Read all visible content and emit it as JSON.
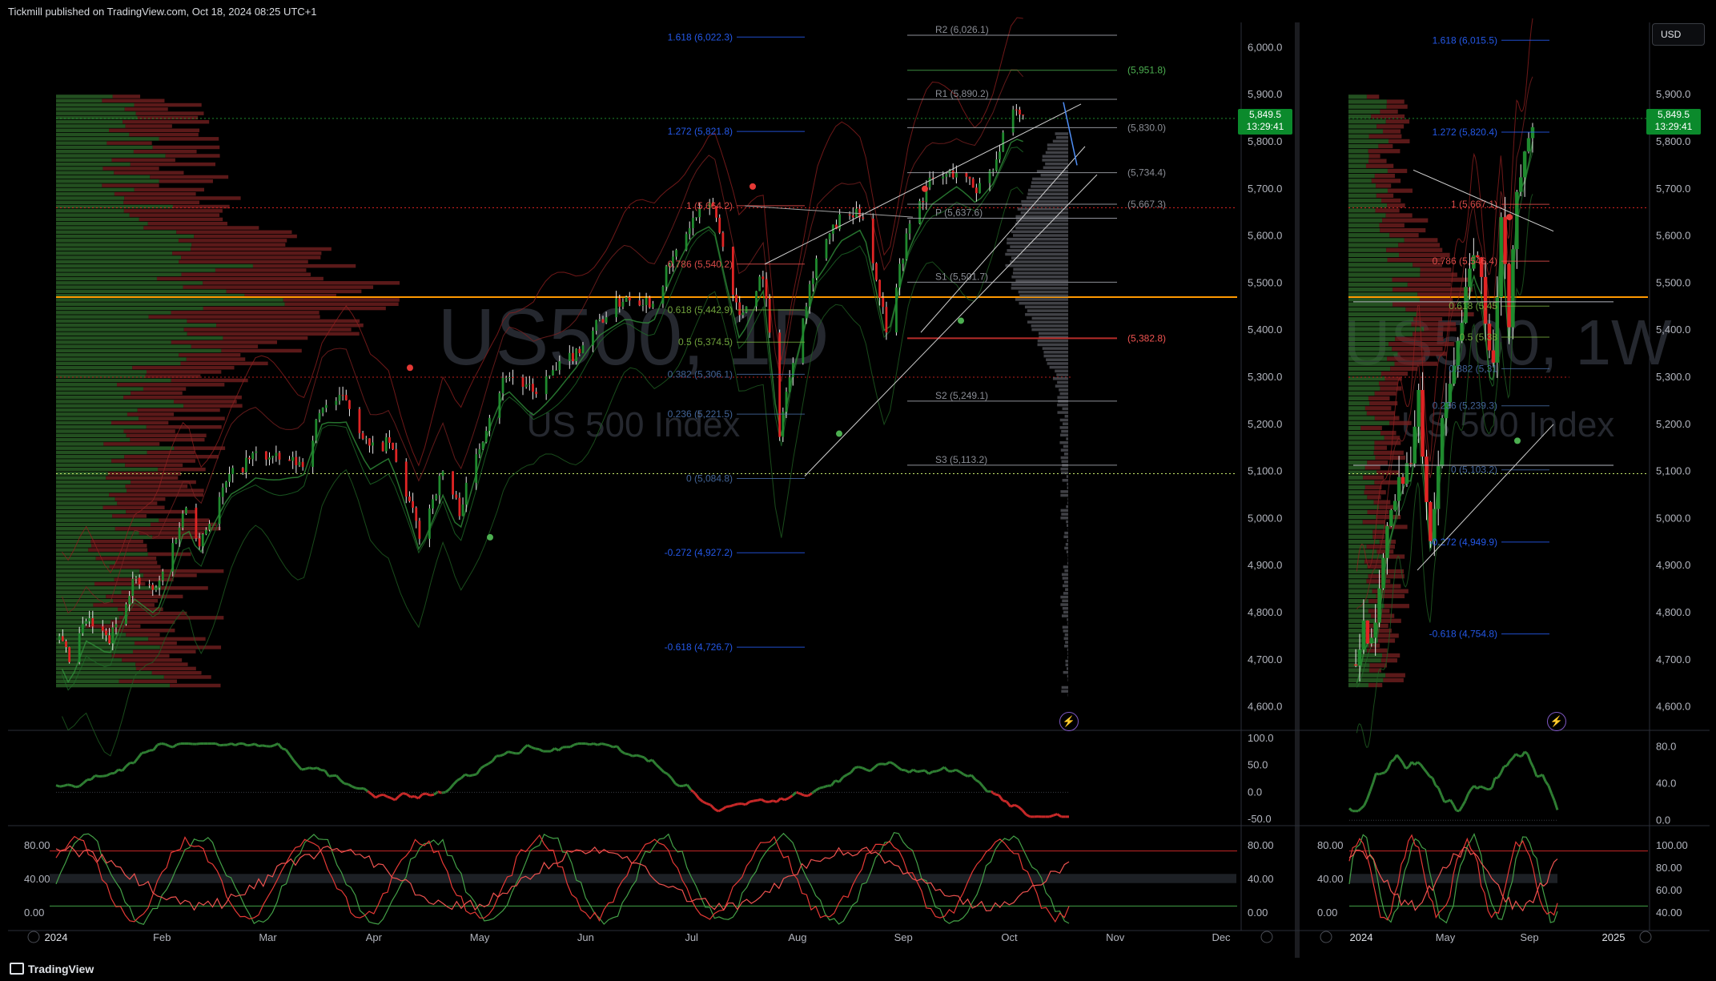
{
  "header": {
    "publish_text": "Tickmill published on TradingView.com, Oct 18, 2024 08:25 UTC+1"
  },
  "footer": {
    "brand": "TradingView"
  },
  "toolbar": {
    "currency": "USD"
  },
  "colors": {
    "up": "#1f8a2e",
    "down": "#e02424",
    "accent_orange": "#ff9800",
    "fib_blue": "#2962ff",
    "pivot_grey": "#b2b5be"
  },
  "icons": [
    "lightning-icon",
    "auto-scale-icon",
    "zoom-icon",
    "tradingview-logo-icon"
  ],
  "chart_data": [
    {
      "type": "candlestick",
      "name": "US500, 1D",
      "watermark_symbol": "US500, 1D",
      "watermark_desc": "US 500 Index",
      "current_price": "5,849.5",
      "countdown": "13:29:41",
      "ylim": [
        4550,
        6050
      ],
      "y_ticks": [
        "6,000.0",
        "5,900.0",
        "5,800.0",
        "5,700.0",
        "5,600.0",
        "5,500.0",
        "5,400.0",
        "5,300.0",
        "5,200.0",
        "5,100.0",
        "5,000.0",
        "4,900.0",
        "4,800.0",
        "4,700.0",
        "4,600.0"
      ],
      "x_ticks": [
        "2024",
        "Feb",
        "Mar",
        "Apr",
        "May",
        "Jun",
        "Jul",
        "Aug",
        "Sep",
        "Oct",
        "Nov",
        "Dec"
      ],
      "x_range": [
        "2024-01-01",
        "2024-12-31"
      ],
      "close_path": [
        [
          "2024-01-02",
          4742
        ],
        [
          "2024-01-05",
          4697
        ],
        [
          "2024-01-10",
          4783
        ],
        [
          "2024-01-17",
          4740
        ],
        [
          "2024-01-24",
          4868
        ],
        [
          "2024-01-31",
          4845
        ],
        [
          "2024-02-09",
          5026
        ],
        [
          "2024-02-13",
          4953
        ],
        [
          "2024-02-22",
          5087
        ],
        [
          "2024-03-01",
          5137
        ],
        [
          "2024-03-08",
          5123
        ],
        [
          "2024-03-15",
          5117
        ],
        [
          "2024-03-21",
          5241
        ],
        [
          "2024-03-28",
          5254
        ],
        [
          "2024-04-04",
          5147
        ],
        [
          "2024-04-10",
          5160
        ],
        [
          "2024-04-19",
          4967
        ],
        [
          "2024-04-26",
          5099
        ],
        [
          "2024-05-01",
          5018
        ],
        [
          "2024-05-10",
          5222
        ],
        [
          "2024-05-15",
          5308
        ],
        [
          "2024-05-23",
          5267
        ],
        [
          "2024-06-05",
          5354
        ],
        [
          "2024-06-12",
          5421
        ],
        [
          "2024-06-20",
          5473
        ],
        [
          "2024-06-28",
          5460
        ],
        [
          "2024-07-03",
          5537
        ],
        [
          "2024-07-10",
          5633
        ],
        [
          "2024-07-16",
          5667
        ],
        [
          "2024-07-24",
          5427
        ],
        [
          "2024-07-31",
          5522
        ],
        [
          "2024-08-05",
          5186
        ],
        [
          "2024-08-09",
          5344
        ],
        [
          "2024-08-16",
          5554
        ],
        [
          "2024-08-23",
          5634
        ],
        [
          "2024-08-30",
          5648
        ],
        [
          "2024-09-06",
          5408
        ],
        [
          "2024-09-13",
          5626
        ],
        [
          "2024-09-19",
          5713
        ],
        [
          "2024-09-27",
          5738
        ],
        [
          "2024-10-03",
          5699
        ],
        [
          "2024-10-08",
          5751
        ],
        [
          "2024-10-14",
          5859
        ],
        [
          "2024-10-17",
          5849.5
        ]
      ],
      "levels": [
        {
          "label": "R2 (6,026.1)",
          "value": 6026.1
        },
        {
          "label": "(5,951.8)",
          "value": 5951.8
        },
        {
          "label": "R1 (5,890.2)",
          "value": 5890.2
        },
        {
          "label": "(5,830.0)",
          "value": 5830.0
        },
        {
          "label": "(5,734.4)",
          "value": 5734.4
        },
        {
          "label": "(5,667.3)",
          "value": 5667.3
        },
        {
          "label": "P (5,637.6)",
          "value": 5637.6
        },
        {
          "label": "S1 (5,501.7)",
          "value": 5501.7
        },
        {
          "label": "(5,382.8)",
          "value": 5382.8
        },
        {
          "label": "S2 (5,249.1)",
          "value": 5249.1
        },
        {
          "label": "S3 (5,113.2)",
          "value": 5113.2
        }
      ],
      "fib_levels": [
        {
          "label": "1.618 (6,022.3)",
          "value": 6022.3
        },
        {
          "label": "1.272 (5,821.8)",
          "value": 5821.8
        },
        {
          "label": "1 (5,664.2)",
          "value": 5664.2
        },
        {
          "label": "0.786 (5,540.2)",
          "value": 5540.2
        },
        {
          "label": "0.618 (5,442.9)",
          "value": 5442.9
        },
        {
          "label": "0.5 (5,374.5)",
          "value": 5374.5
        },
        {
          "label": "0.382 (5,306.1)",
          "value": 5306.1
        },
        {
          "label": "0.236 (5,221.5)",
          "value": 5221.5
        },
        {
          "label": "0 (5,084.8)",
          "value": 5084.8
        },
        {
          "label": "-0.272 (4,927.2)",
          "value": 4927.2
        },
        {
          "label": "-0.618 (4,726.7)",
          "value": 4726.7
        }
      ],
      "osc1": {
        "y_ticks": [
          "100.0",
          "50.0",
          "0.0",
          "-50.0"
        ],
        "ylim": [
          -60,
          110
        ]
      },
      "osc2": {
        "y_ticks_right": [
          "80.00",
          "40.00",
          "0.00"
        ],
        "y_ticks_left": [
          "80.00",
          "40.00",
          "0.00"
        ],
        "ylim": [
          -5,
          105
        ]
      }
    },
    {
      "type": "candlestick",
      "name": "US500, 1W",
      "watermark_symbol": "US500, 1W",
      "watermark_desc": "US 500 Index",
      "current_price": "5,849.5",
      "countdown": "13:29:41",
      "ylim": [
        4550,
        6050
      ],
      "y_ticks": [
        "5,900.0",
        "5,800.0",
        "5,700.0",
        "5,600.0",
        "5,500.0",
        "5,400.0",
        "5,300.0",
        "5,200.0",
        "5,100.0",
        "5,000.0",
        "4,900.0",
        "4,800.0",
        "4,700.0",
        "4,600.0"
      ],
      "x_ticks": [
        "2024",
        "May",
        "Sep",
        "2025"
      ],
      "x_range": [
        "2023-11-01",
        "2025-02-28"
      ],
      "close_path": [
        [
          "2023-12-04",
          4690
        ],
        [
          "2023-12-18",
          4754
        ],
        [
          "2024-01-08",
          4783
        ],
        [
          "2024-01-29",
          4958
        ],
        [
          "2024-02-19",
          5088
        ],
        [
          "2024-03-11",
          5117
        ],
        [
          "2024-03-25",
          5254
        ],
        [
          "2024-04-15",
          4967
        ],
        [
          "2024-04-29",
          5127
        ],
        [
          "2024-05-20",
          5304
        ],
        [
          "2024-06-10",
          5431
        ],
        [
          "2024-07-01",
          5567
        ],
        [
          "2024-07-15",
          5505
        ],
        [
          "2024-07-29",
          5346
        ],
        [
          "2024-08-05",
          5344
        ],
        [
          "2024-08-19",
          5634
        ],
        [
          "2024-09-02",
          5408
        ],
        [
          "2024-09-16",
          5702
        ],
        [
          "2024-09-30",
          5751
        ],
        [
          "2024-10-14",
          5849.5
        ]
      ],
      "fib_levels": [
        {
          "label": "1.618 (6,015.5)",
          "value": 6015.5
        },
        {
          "label": "1.272 (5,820.4)",
          "value": 5820.4
        },
        {
          "label": "1 (5,667.1)",
          "value": 5667.1
        },
        {
          "label": "0.786 (5,546.4)",
          "value": 5546.4
        },
        {
          "label": "0.618 (5,45",
          "value": 5451.0
        },
        {
          "label": "0.5 (5,38",
          "value": 5385.0
        },
        {
          "label": "0.382 (5,31",
          "value": 5318.0
        },
        {
          "label": "0.236 (5,239.3)",
          "value": 5239.3
        },
        {
          "label": "0 (5,103.2)",
          "value": 5103.2
        },
        {
          "label": "-0.272 (4,949.9)",
          "value": 4949.9
        },
        {
          "label": "-0.618 (4,754.8)",
          "value": 4754.8
        }
      ],
      "osc1": {
        "y_ticks": [
          "80.0",
          "40.0",
          "0.0"
        ],
        "ylim": [
          -5,
          95
        ]
      },
      "osc2": {
        "y_ticks_right": [
          "100.00",
          "80.00",
          "60.00",
          "40.00"
        ],
        "y_ticks_left": [
          "80.00",
          "40.00",
          "0.00"
        ],
        "ylim": [
          -5,
          105
        ]
      }
    }
  ]
}
